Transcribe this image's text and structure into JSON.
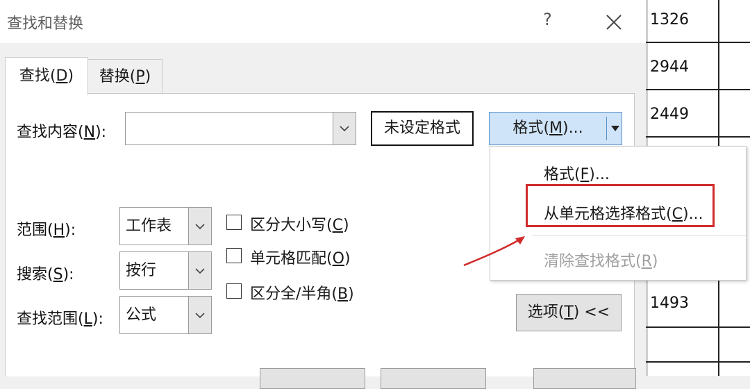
{
  "dialog": {
    "title": "查找和替换",
    "help_glyph": "?",
    "tabs": [
      {
        "text": "查找",
        "key": "D"
      },
      {
        "text": "替换",
        "key": "P"
      }
    ],
    "find_what": {
      "label": "查找内容",
      "key": "N",
      "suffix": "):",
      "value": ""
    },
    "format_preview": "未设定格式",
    "format_button": {
      "text": "格式",
      "key": "M",
      "suffix": ")..."
    },
    "within": {
      "label": "范围",
      "key": "H",
      "suffix": "):",
      "value": "工作表"
    },
    "search": {
      "label": "搜索",
      "key": "S",
      "suffix": "):",
      "value": "按行"
    },
    "look_in": {
      "label": "查找范围",
      "key": "L",
      "suffix": "):",
      "value": "公式"
    },
    "checkboxes": [
      {
        "text": "区分大小写",
        "key": "C",
        "checked": false
      },
      {
        "text": "单元格匹配",
        "key": "O",
        "checked": false
      },
      {
        "text": "区分全/半角",
        "key": "B",
        "checked": false
      }
    ],
    "options_button": {
      "text": "选项",
      "key": "T",
      "suffix": ") <<"
    }
  },
  "format_menu": {
    "items": [
      {
        "text": "格式",
        "key": "F",
        "suffix": ")...",
        "enabled": true
      },
      {
        "text": "从单元格选择格式",
        "key": "C",
        "suffix": ")...",
        "enabled": true,
        "highlighted": true
      },
      {
        "text": "清除查找格式",
        "key": "R",
        "suffix": ")",
        "enabled": false
      }
    ]
  },
  "sheet": {
    "cells": [
      "1326",
      "2944",
      "2449",
      "1493"
    ]
  },
  "colors": {
    "highlight": "#d12a2a",
    "format_button_bg": "#cfe4f8",
    "disabled_text": "#a0a0a0"
  }
}
